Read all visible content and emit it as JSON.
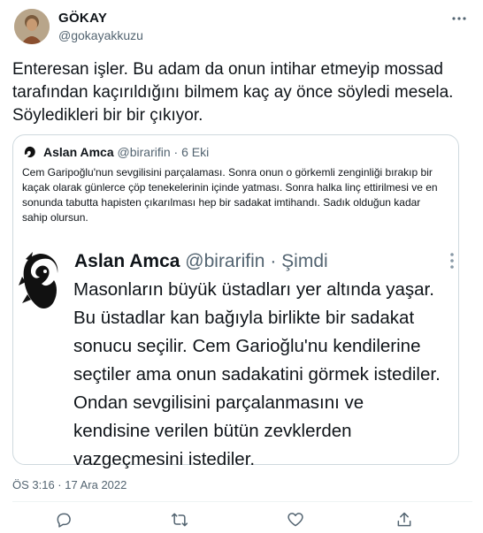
{
  "author": {
    "name": "GÖKAY",
    "handle": "@gokayakkuzu"
  },
  "tweet_text": "Enteresan işler. Bu adam da onun intihar etmeyip mossad tarafından kaçırıldığını bilmem kaç ay önce söyledi mesela. Söyledikleri bir bir çıkıyor.",
  "quote": {
    "name": "Aslan Amca",
    "handle": "@birarifin",
    "separator": "·",
    "time": "6 Eki",
    "text": "Cem Garipoğlu'nun sevgilisini parçalaması. Sonra onun o görkemli zenginliği bırakıp bir kaçak olarak  günlerce çöp tenekelerinin içinde yatması. Sonra halka linç ettirilmesi ve en sonunda tabutta hapisten çıkarılması hep bir sadakat imtihandı. Sadık olduğun kadar sahip olursun.",
    "inner": {
      "name": "Aslan Amca",
      "handle": "@birarifin",
      "separator": "·",
      "time": "Şimdi",
      "text": "Masonların büyük üstadları yer altında yaşar. Bu üstadlar kan bağıyla birlikte bir sadakat sonucu seçilir. Cem Garioğlu'nu kendilerine seçtiler ama onun sadakatini görmek istediler. Ondan sevgilisini parçalanmasını ve kendisine verilen bütün zevklerden vazgeçmesini istediler."
    }
  },
  "timestamp": "ÖS 3:16 · 17 Ara 2022",
  "actions": [
    {
      "icon": "reply-icon"
    },
    {
      "icon": "retweet-icon"
    },
    {
      "icon": "like-icon"
    },
    {
      "icon": "share-icon"
    }
  ],
  "colors": {
    "text": "#0f1419",
    "secondary": "#536471",
    "border": "#cfd9de"
  }
}
